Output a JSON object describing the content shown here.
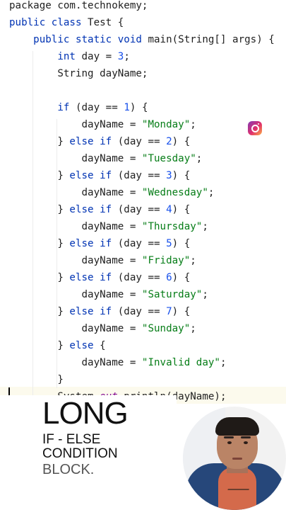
{
  "code_lines": [
    [
      {
        "t": "package com.technokemy;"
      }
    ],
    [
      {
        "t": "public class ",
        "c": "k"
      },
      {
        "t": "Test {"
      }
    ],
    [
      {
        "t": "    "
      },
      {
        "t": "public static void ",
        "c": "k"
      },
      {
        "t": "main(String[] args) {"
      }
    ],
    [
      {
        "t": "        "
      },
      {
        "t": "int ",
        "c": "k"
      },
      {
        "t": "day = "
      },
      {
        "t": "3",
        "c": "n"
      },
      {
        "t": ";"
      }
    ],
    [
      {
        "t": "        String dayName;"
      }
    ],
    [
      {
        "t": ""
      }
    ],
    [
      {
        "t": "        "
      },
      {
        "t": "if ",
        "c": "k"
      },
      {
        "t": "(day == "
      },
      {
        "t": "1",
        "c": "n"
      },
      {
        "t": ") {"
      }
    ],
    [
      {
        "t": "            dayName = "
      },
      {
        "t": "\"Monday\"",
        "c": "s"
      },
      {
        "t": ";"
      }
    ],
    [
      {
        "t": "        } "
      },
      {
        "t": "else if ",
        "c": "k"
      },
      {
        "t": "(day == "
      },
      {
        "t": "2",
        "c": "n"
      },
      {
        "t": ") {"
      }
    ],
    [
      {
        "t": "            dayName = "
      },
      {
        "t": "\"Tuesday\"",
        "c": "s"
      },
      {
        "t": ";"
      }
    ],
    [
      {
        "t": "        } "
      },
      {
        "t": "else if ",
        "c": "k"
      },
      {
        "t": "(day == "
      },
      {
        "t": "3",
        "c": "n"
      },
      {
        "t": ") {"
      }
    ],
    [
      {
        "t": "            dayName = "
      },
      {
        "t": "\"Wednesday\"",
        "c": "s"
      },
      {
        "t": ";"
      }
    ],
    [
      {
        "t": "        } "
      },
      {
        "t": "else if ",
        "c": "k"
      },
      {
        "t": "(day == "
      },
      {
        "t": "4",
        "c": "n"
      },
      {
        "t": ") {"
      }
    ],
    [
      {
        "t": "            dayName = "
      },
      {
        "t": "\"Thursday\"",
        "c": "s"
      },
      {
        "t": ";"
      }
    ],
    [
      {
        "t": "        } "
      },
      {
        "t": "else if ",
        "c": "k"
      },
      {
        "t": "(day == "
      },
      {
        "t": "5",
        "c": "n"
      },
      {
        "t": ") {"
      }
    ],
    [
      {
        "t": "            dayName = "
      },
      {
        "t": "\"Friday\"",
        "c": "s"
      },
      {
        "t": ";"
      }
    ],
    [
      {
        "t": "        } "
      },
      {
        "t": "else if ",
        "c": "k"
      },
      {
        "t": "(day == "
      },
      {
        "t": "6",
        "c": "n"
      },
      {
        "t": ") {"
      }
    ],
    [
      {
        "t": "            dayName = "
      },
      {
        "t": "\"Saturday\"",
        "c": "s"
      },
      {
        "t": ";"
      }
    ],
    [
      {
        "t": "        } "
      },
      {
        "t": "else if ",
        "c": "k"
      },
      {
        "t": "(day == "
      },
      {
        "t": "7",
        "c": "n"
      },
      {
        "t": ") {"
      }
    ],
    [
      {
        "t": "            dayName = "
      },
      {
        "t": "\"Sunday\"",
        "c": "s"
      },
      {
        "t": ";"
      }
    ],
    [
      {
        "t": "        } "
      },
      {
        "t": "else ",
        "c": "k"
      },
      {
        "t": "{"
      }
    ],
    [
      {
        "t": "            dayName = "
      },
      {
        "t": "\"Invalid day\"",
        "c": "s"
      },
      {
        "t": ";"
      }
    ],
    [
      {
        "t": "        }"
      }
    ],
    [
      {
        "t": "        System."
      },
      {
        "t": "out",
        "c": "f"
      },
      {
        "t": ".println(dayName);"
      }
    ],
    [
      {
        "t": "    }"
      }
    ],
    [
      {
        "t": "}"
      }
    ]
  ],
  "syntax_colors": {
    "keyword": "#0033b3",
    "string": "#067d17",
    "number": "#1750eb",
    "field": "#871094",
    "text": "#1f1f1f"
  },
  "caption": {
    "line1": "LONG",
    "line2": "IF - ELSE",
    "line3": "CONDITION",
    "line4": "BLOCK."
  },
  "overlays": {
    "instagram_icon": "instagram-icon",
    "presenter": "presenter-avatar"
  }
}
